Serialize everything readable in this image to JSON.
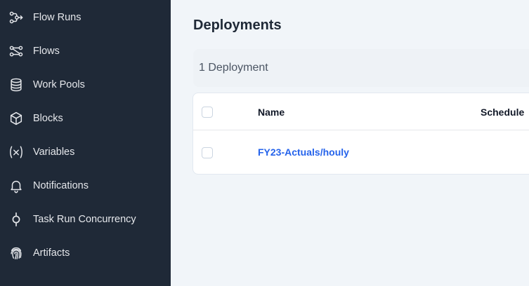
{
  "sidebar": {
    "items": [
      {
        "label": "Flow Runs",
        "icon": "flow-runs-icon"
      },
      {
        "label": "Flows",
        "icon": "flows-icon"
      },
      {
        "label": "Work Pools",
        "icon": "database-icon"
      },
      {
        "label": "Blocks",
        "icon": "cube-icon"
      },
      {
        "label": "Variables",
        "icon": "variable-icon"
      },
      {
        "label": "Notifications",
        "icon": "bell-icon"
      },
      {
        "label": "Task Run Concurrency",
        "icon": "concurrency-icon"
      },
      {
        "label": "Artifacts",
        "icon": "fingerprint-icon"
      }
    ]
  },
  "main": {
    "title": "Deployments",
    "count_label": "1 Deployment",
    "table": {
      "columns": [
        "Name",
        "Schedule"
      ],
      "rows": [
        {
          "name": "FY23-Actuals/houly",
          "schedule": ""
        }
      ]
    }
  },
  "colors": {
    "sidebar_bg": "#1f2937",
    "link": "#2563eb",
    "page_bg": "#f1f5f9"
  }
}
